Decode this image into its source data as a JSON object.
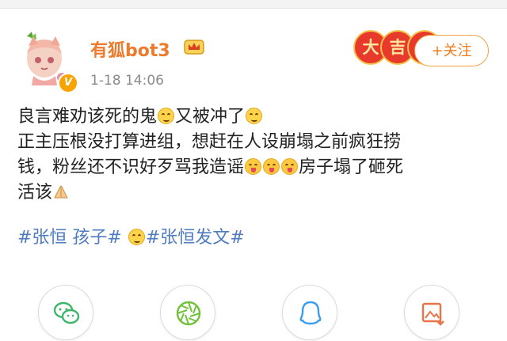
{
  "post": {
    "username": "有狐bot3",
    "time": "1-18 14:06",
    "badges": [
      "大",
      "吉"
    ],
    "follow_label": "+关注",
    "verified_mark": "V",
    "text_lines": [
      [
        "良言难劝该死的鬼",
        "又被冲了"
      ],
      [
        "正主压根没打算进组，想赶在人设崩塌之前疯狂捞"
      ],
      [
        "钱，粉丝还不识好歹骂我造谣",
        "房子塌了砸死"
      ],
      [
        "活该"
      ]
    ],
    "tags": [
      "#张恒 孩子#",
      "#张恒发文#"
    ]
  },
  "icons": {
    "avatar": "anime-fox-girl-avatar",
    "verified": "verified-badge-icon",
    "crown": "crown-icon",
    "emoji_1": "grimace-emoji",
    "emoji_2": "grimace-emoji",
    "emoji_3": "tongue-emoji",
    "pray": "pray-hands-emoji",
    "share": [
      "wechat-icon",
      "moments-icon",
      "qq-icon",
      "save-image-icon"
    ]
  },
  "colors": {
    "username": "#ee7a2c",
    "tag": "#4f7bbf",
    "badge": "#e8392d",
    "follow": "#f07b1d"
  }
}
